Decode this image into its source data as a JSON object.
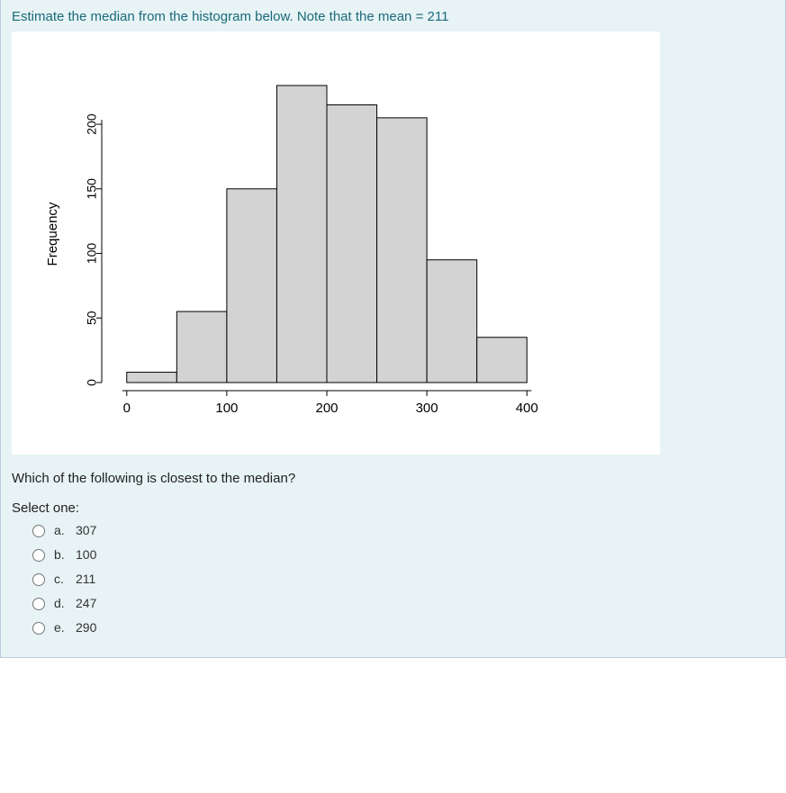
{
  "question": {
    "prompt": "Estimate the median from the histogram below. Note that the mean = 211",
    "subquestion": "Which of the following is closest to the median?",
    "select_label": "Select one:",
    "options": [
      {
        "letter": "a.",
        "text": "307"
      },
      {
        "letter": "b.",
        "text": "100"
      },
      {
        "letter": "c.",
        "text": "211"
      },
      {
        "letter": "d.",
        "text": "247"
      },
      {
        "letter": "e.",
        "text": "290"
      }
    ]
  },
  "chart_data": {
    "type": "bar",
    "title": "",
    "xlabel": "",
    "ylabel": "Frequency",
    "x_ticks": [
      0,
      100,
      200,
      300,
      400
    ],
    "y_ticks": [
      0,
      50,
      100,
      150,
      200
    ],
    "ylim": [
      0,
      230
    ],
    "xlim": [
      -25,
      425
    ],
    "bin_width": 50,
    "bins_start": [
      0,
      50,
      100,
      150,
      200,
      250,
      300,
      350
    ],
    "values": [
      8,
      55,
      150,
      230,
      215,
      205,
      95,
      35
    ]
  }
}
